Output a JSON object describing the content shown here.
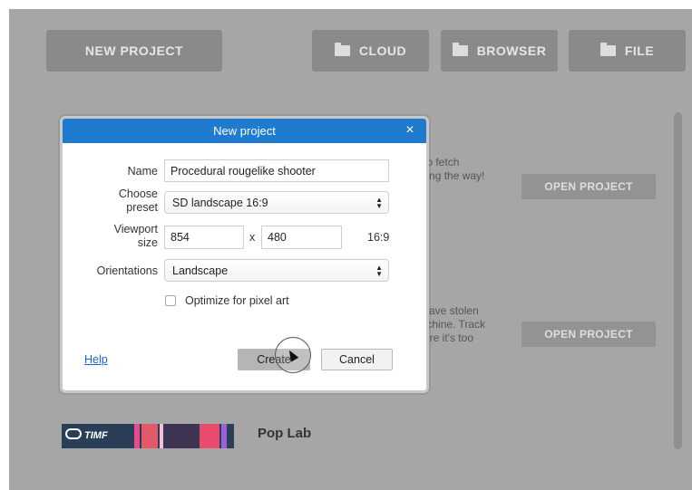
{
  "toolbar": {
    "new_project": "NEW PROJECT",
    "cloud": "CLOUD",
    "browser": "BROWSER",
    "file": "FILE"
  },
  "background_projects": [
    {
      "desc": "o to fetch\nalong the way!",
      "open": "OPEN PROJECT"
    },
    {
      "desc": "s have stolen\nnachine. Track\nefore it's too",
      "open": "OPEN PROJECT"
    }
  ],
  "pop_lab": {
    "title": "Pop Lab",
    "thumb_text": "TIMF"
  },
  "dialog": {
    "title": "New project",
    "close": "×",
    "name_label": "Name",
    "name_value": "Procedural rougelike shooter",
    "preset_label": "Choose\npreset",
    "preset_value": "SD landscape 16:9",
    "viewport_label": "Viewport\nsize",
    "viewport_width": "854",
    "viewport_x": "x",
    "viewport_height": "480",
    "aspect": "16:9",
    "orientations_label": "Orientations",
    "orientations_value": "Landscape",
    "pixel_art_label": "Optimize for pixel art",
    "help": "Help",
    "create": "Create",
    "cancel": "Cancel"
  },
  "colors": {
    "titlebar": "#1e7bcf",
    "overlay": "#a6a6a6",
    "toolbar_button": "#8a8a8a"
  }
}
